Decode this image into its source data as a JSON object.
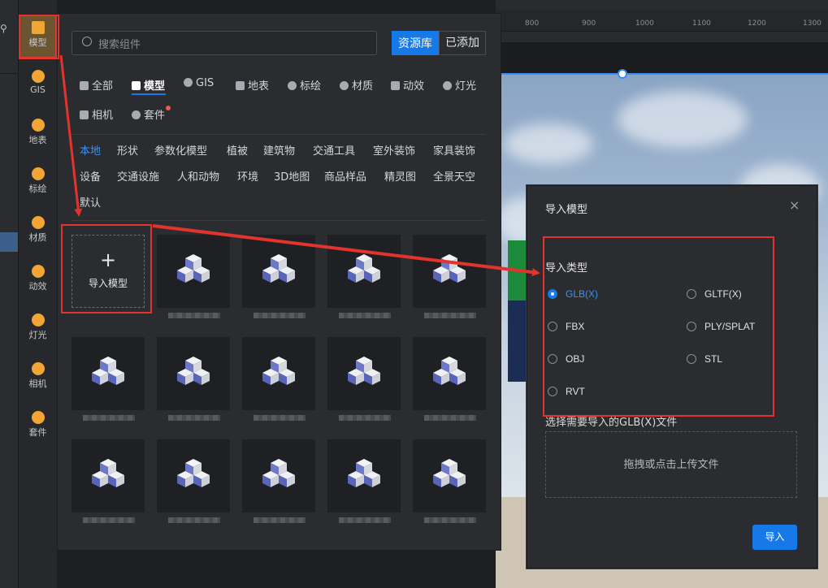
{
  "ruler": {
    "ticks": [
      "800",
      "900",
      "1000",
      "1100",
      "1200",
      "1300"
    ]
  },
  "rail": {
    "items": [
      {
        "label": "模型",
        "icon": "model-icon",
        "active": true
      },
      {
        "label": "GIS",
        "icon": "gis-icon"
      },
      {
        "label": "地表",
        "icon": "terrain-icon"
      },
      {
        "label": "标绘",
        "icon": "pin-icon"
      },
      {
        "label": "材质",
        "icon": "material-icon"
      },
      {
        "label": "动效",
        "icon": "effect-icon"
      },
      {
        "label": "灯光",
        "icon": "light-icon"
      },
      {
        "label": "相机",
        "icon": "camera-icon"
      },
      {
        "label": "套件",
        "icon": "kit-icon"
      }
    ]
  },
  "panel": {
    "search_placeholder": "搜索组件",
    "lib_button": "资源库",
    "added_button": "已添加",
    "categories": [
      "全部",
      "模型",
      "GIS",
      "地表",
      "标绘",
      "材质",
      "动效",
      "灯光",
      "相机",
      "套件"
    ],
    "subcategories": [
      "本地",
      "形状",
      "参数化模型",
      "植被",
      "建筑物",
      "交通工具",
      "室外装饰",
      "家具装饰",
      "设备",
      "交通设施",
      "人和动物",
      "环境",
      "3D地图",
      "商品样品",
      "精灵图",
      "全景天空",
      "默认"
    ],
    "import_tile_label": "导入模型"
  },
  "dialog": {
    "title": "导入模型",
    "close": "×",
    "type_label": "导入类型",
    "types": [
      "GLB(X)",
      "GLTF(X)",
      "FBX",
      "PLY/SPLAT",
      "OBJ",
      "STL",
      "RVT"
    ],
    "selected_type": "GLB(X)",
    "file_label": "选择需要导入的GLB(X)文件",
    "dropzone_text": "拖拽或点击上传文件",
    "import_button": "导入"
  },
  "colors": {
    "accent": "#1779e8",
    "annotation": "#e2332c",
    "rail_active": "#6b5430"
  }
}
